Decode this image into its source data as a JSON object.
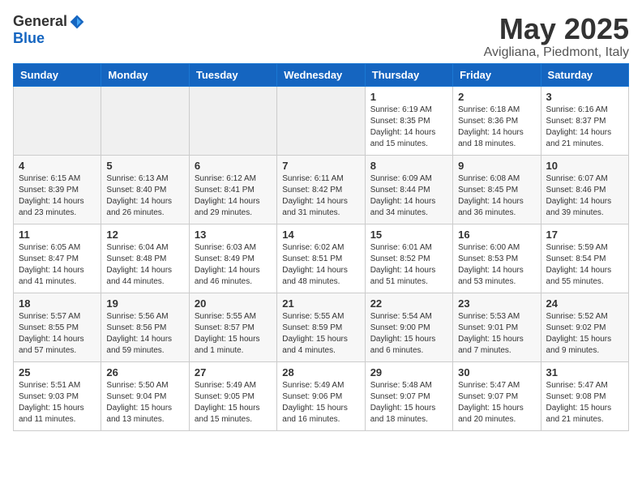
{
  "logo": {
    "general": "General",
    "blue": "Blue"
  },
  "title": "May 2025",
  "location": "Avigliana, Piedmont, Italy",
  "headers": [
    "Sunday",
    "Monday",
    "Tuesday",
    "Wednesday",
    "Thursday",
    "Friday",
    "Saturday"
  ],
  "weeks": [
    [
      {
        "day": "",
        "info": ""
      },
      {
        "day": "",
        "info": ""
      },
      {
        "day": "",
        "info": ""
      },
      {
        "day": "",
        "info": ""
      },
      {
        "day": "1",
        "info": "Sunrise: 6:19 AM\nSunset: 8:35 PM\nDaylight: 14 hours and 15 minutes."
      },
      {
        "day": "2",
        "info": "Sunrise: 6:18 AM\nSunset: 8:36 PM\nDaylight: 14 hours and 18 minutes."
      },
      {
        "day": "3",
        "info": "Sunrise: 6:16 AM\nSunset: 8:37 PM\nDaylight: 14 hours and 21 minutes."
      }
    ],
    [
      {
        "day": "4",
        "info": "Sunrise: 6:15 AM\nSunset: 8:39 PM\nDaylight: 14 hours and 23 minutes."
      },
      {
        "day": "5",
        "info": "Sunrise: 6:13 AM\nSunset: 8:40 PM\nDaylight: 14 hours and 26 minutes."
      },
      {
        "day": "6",
        "info": "Sunrise: 6:12 AM\nSunset: 8:41 PM\nDaylight: 14 hours and 29 minutes."
      },
      {
        "day": "7",
        "info": "Sunrise: 6:11 AM\nSunset: 8:42 PM\nDaylight: 14 hours and 31 minutes."
      },
      {
        "day": "8",
        "info": "Sunrise: 6:09 AM\nSunset: 8:44 PM\nDaylight: 14 hours and 34 minutes."
      },
      {
        "day": "9",
        "info": "Sunrise: 6:08 AM\nSunset: 8:45 PM\nDaylight: 14 hours and 36 minutes."
      },
      {
        "day": "10",
        "info": "Sunrise: 6:07 AM\nSunset: 8:46 PM\nDaylight: 14 hours and 39 minutes."
      }
    ],
    [
      {
        "day": "11",
        "info": "Sunrise: 6:05 AM\nSunset: 8:47 PM\nDaylight: 14 hours and 41 minutes."
      },
      {
        "day": "12",
        "info": "Sunrise: 6:04 AM\nSunset: 8:48 PM\nDaylight: 14 hours and 44 minutes."
      },
      {
        "day": "13",
        "info": "Sunrise: 6:03 AM\nSunset: 8:49 PM\nDaylight: 14 hours and 46 minutes."
      },
      {
        "day": "14",
        "info": "Sunrise: 6:02 AM\nSunset: 8:51 PM\nDaylight: 14 hours and 48 minutes."
      },
      {
        "day": "15",
        "info": "Sunrise: 6:01 AM\nSunset: 8:52 PM\nDaylight: 14 hours and 51 minutes."
      },
      {
        "day": "16",
        "info": "Sunrise: 6:00 AM\nSunset: 8:53 PM\nDaylight: 14 hours and 53 minutes."
      },
      {
        "day": "17",
        "info": "Sunrise: 5:59 AM\nSunset: 8:54 PM\nDaylight: 14 hours and 55 minutes."
      }
    ],
    [
      {
        "day": "18",
        "info": "Sunrise: 5:57 AM\nSunset: 8:55 PM\nDaylight: 14 hours and 57 minutes."
      },
      {
        "day": "19",
        "info": "Sunrise: 5:56 AM\nSunset: 8:56 PM\nDaylight: 14 hours and 59 minutes."
      },
      {
        "day": "20",
        "info": "Sunrise: 5:55 AM\nSunset: 8:57 PM\nDaylight: 15 hours and 1 minute."
      },
      {
        "day": "21",
        "info": "Sunrise: 5:55 AM\nSunset: 8:59 PM\nDaylight: 15 hours and 4 minutes."
      },
      {
        "day": "22",
        "info": "Sunrise: 5:54 AM\nSunset: 9:00 PM\nDaylight: 15 hours and 6 minutes."
      },
      {
        "day": "23",
        "info": "Sunrise: 5:53 AM\nSunset: 9:01 PM\nDaylight: 15 hours and 7 minutes."
      },
      {
        "day": "24",
        "info": "Sunrise: 5:52 AM\nSunset: 9:02 PM\nDaylight: 15 hours and 9 minutes."
      }
    ],
    [
      {
        "day": "25",
        "info": "Sunrise: 5:51 AM\nSunset: 9:03 PM\nDaylight: 15 hours and 11 minutes."
      },
      {
        "day": "26",
        "info": "Sunrise: 5:50 AM\nSunset: 9:04 PM\nDaylight: 15 hours and 13 minutes."
      },
      {
        "day": "27",
        "info": "Sunrise: 5:49 AM\nSunset: 9:05 PM\nDaylight: 15 hours and 15 minutes."
      },
      {
        "day": "28",
        "info": "Sunrise: 5:49 AM\nSunset: 9:06 PM\nDaylight: 15 hours and 16 minutes."
      },
      {
        "day": "29",
        "info": "Sunrise: 5:48 AM\nSunset: 9:07 PM\nDaylight: 15 hours and 18 minutes."
      },
      {
        "day": "30",
        "info": "Sunrise: 5:47 AM\nSunset: 9:07 PM\nDaylight: 15 hours and 20 minutes."
      },
      {
        "day": "31",
        "info": "Sunrise: 5:47 AM\nSunset: 9:08 PM\nDaylight: 15 hours and 21 minutes."
      }
    ]
  ]
}
